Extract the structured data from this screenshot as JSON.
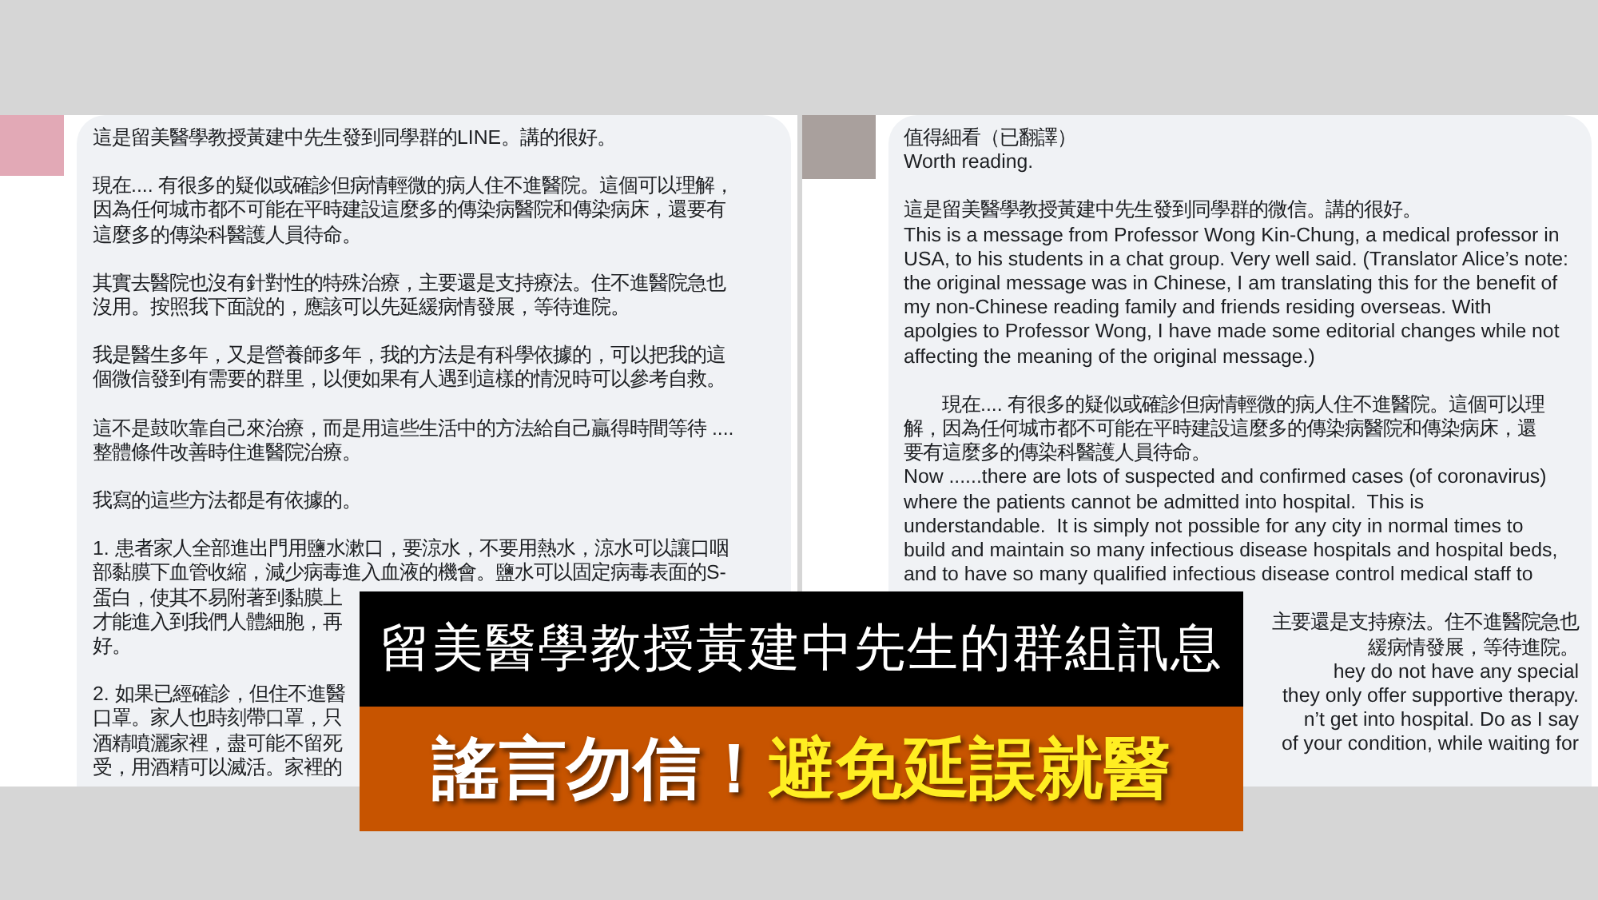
{
  "posts": [
    {
      "paragraphs": [
        {
          "lines": [
            {
              "kind": "full",
              "text": "這是留美醫學教授黃建中先生發到同學群的LINE。講的很好。"
            }
          ]
        },
        {
          "lines": [
            {
              "kind": "full",
              "text": "現在.... 有很多的疑似或確診但病情輕微的病人住不進醫院。這個可以理解，"
            },
            {
              "kind": "full",
              "text": "因為任何城市都不可能在平時建設這麼多的傳染病醫院和傳染病床，還要有"
            },
            {
              "kind": "full",
              "text": "這麼多的傳染科醫護人員待命。"
            }
          ]
        },
        {
          "lines": [
            {
              "kind": "full",
              "text": "其實去醫院也沒有針對性的特殊治療，主要還是支持療法。住不進醫院急也"
            },
            {
              "kind": "full",
              "text": "沒用。按照我下面說的，應該可以先延緩病情發展，等待進院。"
            }
          ]
        },
        {
          "lines": [
            {
              "kind": "full",
              "text": "我是醫生多年，又是營養師多年，我的方法是有科學依據的，可以把我的這"
            },
            {
              "kind": "full",
              "text": "個微信發到有需要的群里，以便如果有人遇到這樣的情況時可以參考自救。"
            }
          ]
        },
        {
          "lines": [
            {
              "kind": "full",
              "text": "這不是鼓吹靠自己來治療，而是用這些生活中的方法給自己贏得時間等待 ...."
            },
            {
              "kind": "full",
              "text": "整體條件改善時住進醫院治療。"
            }
          ]
        },
        {
          "lines": [
            {
              "kind": "full",
              "text": "我寫的這些方法都是有依據的。"
            }
          ]
        },
        {
          "lines": [
            {
              "kind": "full",
              "text": "1. 患者家人全部進出門用鹽水漱口，要涼水，不要用熱水，涼水可以讓口咽"
            },
            {
              "kind": "full",
              "text": "部黏膜下血管收縮，減少病毒進入血液的機會。鹽水可以固定病毒表面的S-"
            },
            {
              "kind": "head",
              "text": "蛋白，使其不易附著到黏膜上"
            },
            {
              "kind": "head",
              "text": "才能進入到我們人體細胞，再"
            },
            {
              "kind": "head",
              "text": "好。"
            }
          ]
        },
        {
          "lines": [
            {
              "kind": "head",
              "text": "2. 如果已經確診，但住不進醫"
            },
            {
              "kind": "head",
              "text": "口罩。家人也時刻帶口罩，只"
            },
            {
              "kind": "head",
              "text": "酒精噴灑家裡，盡可能不留死"
            },
            {
              "kind": "head",
              "text": "受，用酒精可以滅活。家裡的"
            }
          ]
        }
      ]
    },
    {
      "paragraphs": [
        {
          "lines": [
            {
              "kind": "full",
              "text": "值得細看（已翻譯）"
            },
            {
              "kind": "full",
              "text": "Worth reading."
            }
          ]
        },
        {
          "lines": [
            {
              "kind": "full",
              "text": "這是留美醫學教授黃建中先生發到同學群的微信。講的很好。"
            },
            {
              "kind": "full",
              "text": "This is a message from Professor Wong Kin-Chung, a medical professor in"
            },
            {
              "kind": "full",
              "text": "USA, to his students in a chat group. Very well said. (Translator Alice’s note:"
            },
            {
              "kind": "full",
              "text": "the original message was in Chinese, I am translating this for the benefit of"
            },
            {
              "kind": "full",
              "text": "my non-Chinese reading family and friends residing overseas. With"
            },
            {
              "kind": "full",
              "text": "apolgies to Professor Wong, I have made some editorial changes while not"
            },
            {
              "kind": "full",
              "text": "affecting the meaning of the original message.)"
            }
          ]
        },
        {
          "lines": [
            {
              "kind": "full",
              "text": "　　現在.... 有很多的疑似或確診但病情輕微的病人住不進醫院。這個可以理"
            },
            {
              "kind": "full",
              "text": "解，因為任何城市都不可能在平時建設這麼多的傳染病醫院和傳染病床，還"
            },
            {
              "kind": "full",
              "text": "要有這麼多的傳染科醫護人員待命。"
            },
            {
              "kind": "full",
              "text": "Now ......there are lots of suspected and confirmed cases (of coronavirus)"
            },
            {
              "kind": "full",
              "text": "where the patients cannot be admitted into hospital.  This is"
            },
            {
              "kind": "full",
              "text": "understandable.  It is simply not possible for any city in normal times to"
            },
            {
              "kind": "full",
              "text": "build and maintain so many infectious disease hospitals and hospital beds,"
            },
            {
              "kind": "full",
              "text": "and to have so many qualified infectious disease control medical staff to"
            }
          ]
        },
        {
          "lines": [
            {
              "kind": "tail",
              "text": "主要還是支持療法。住不進醫院急也"
            },
            {
              "kind": "tail",
              "text": "緩病情發展，等待進院。"
            },
            {
              "kind": "tail",
              "text": "hey do not have any special"
            },
            {
              "kind": "tail",
              "text": "they only offer supportive therapy."
            },
            {
              "kind": "tail",
              "text": "n’t get into hospital. Do as I say"
            },
            {
              "kind": "tail",
              "text": "of your condition, while waiting for"
            }
          ]
        }
      ]
    }
  ],
  "banner": {
    "title": "留美醫學教授黃建中先生的群組訊息",
    "headline": [
      {
        "text": "謠言勿信！",
        "color": "#ffffff"
      },
      {
        "text": "避免延誤就醫",
        "color": "#ffee22"
      }
    ]
  }
}
